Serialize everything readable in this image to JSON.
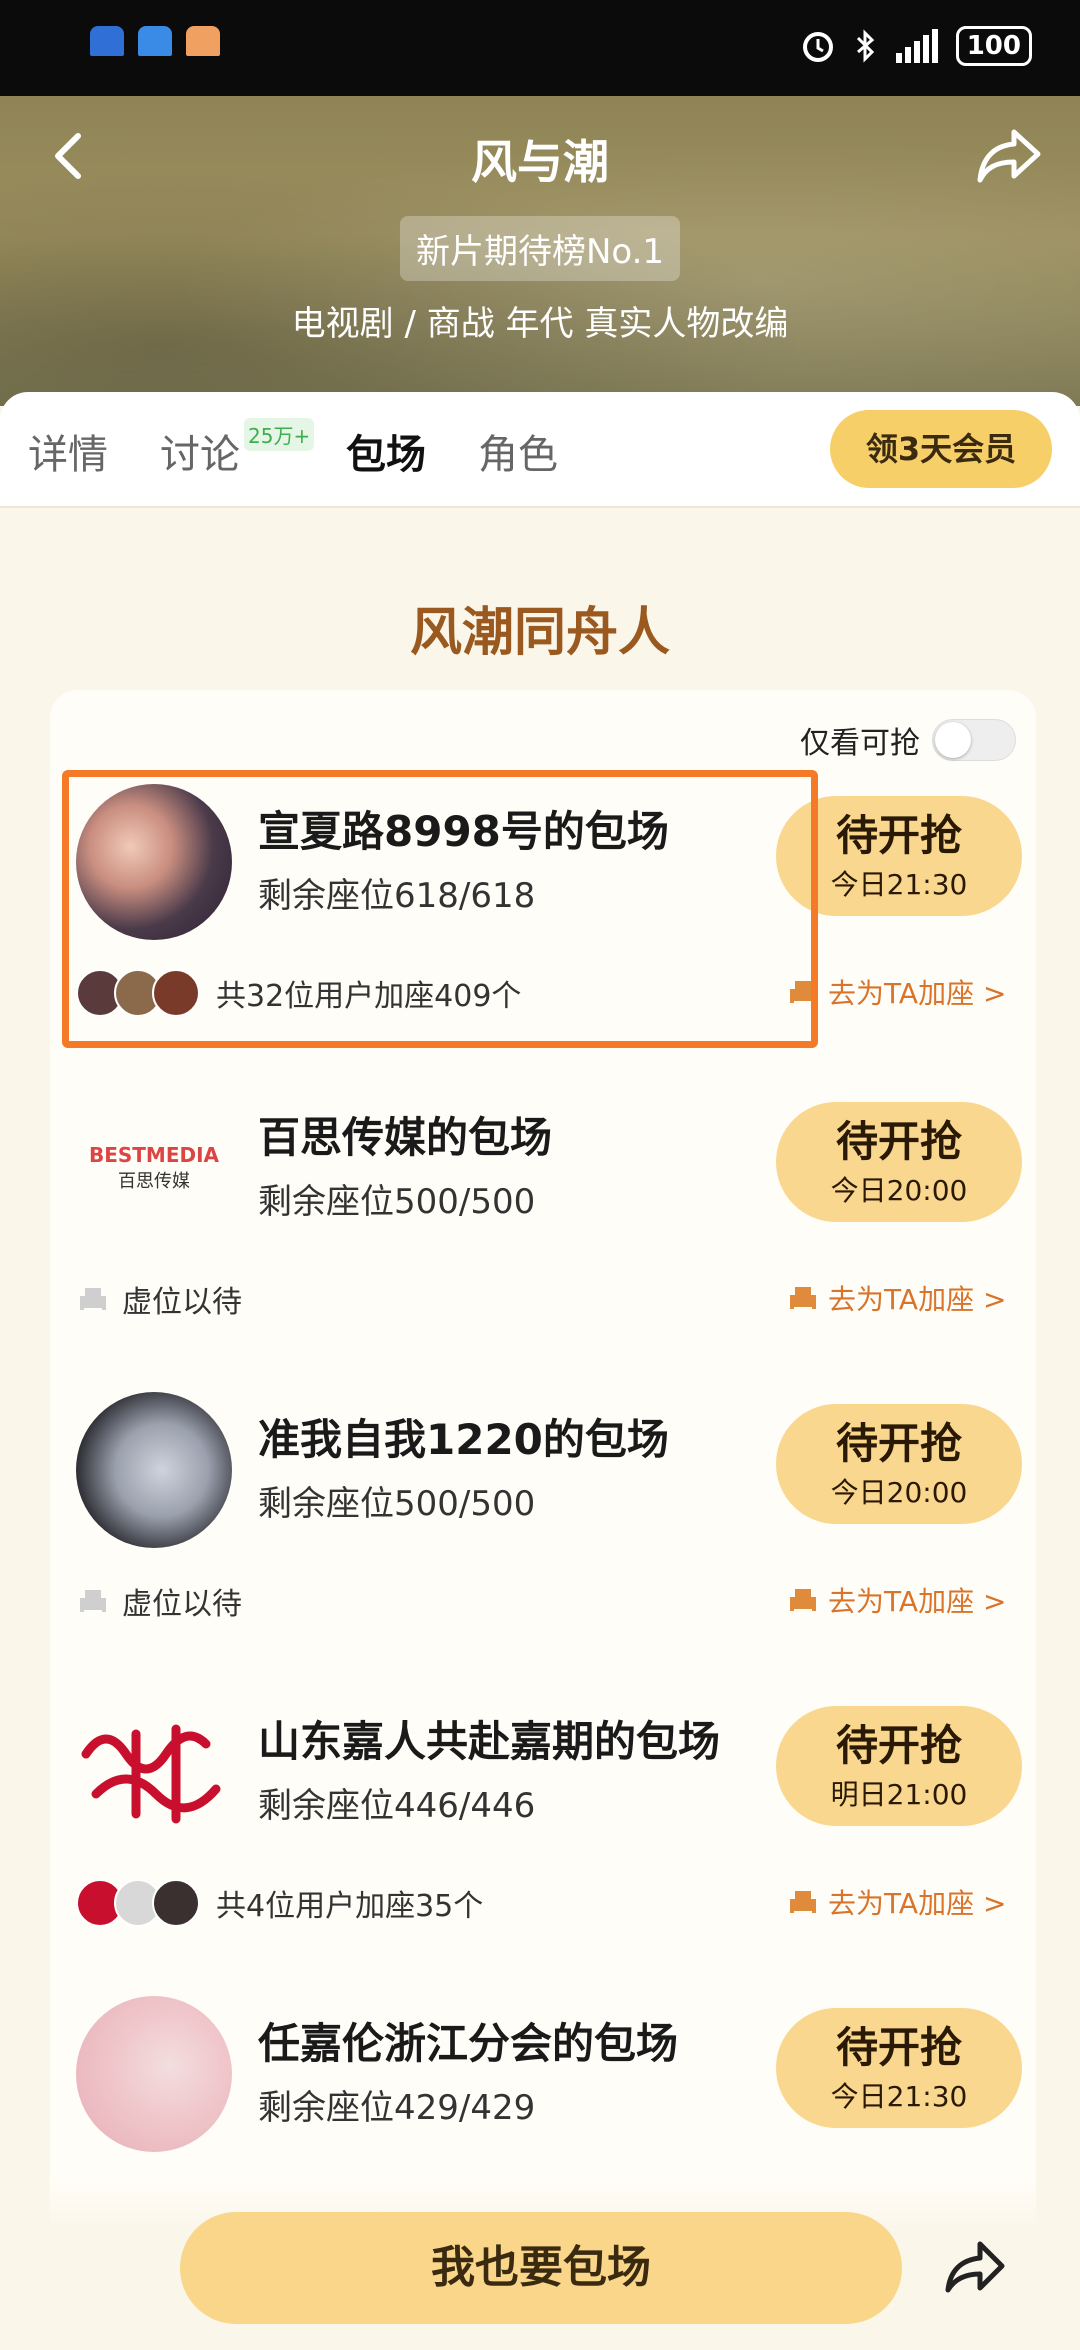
{
  "colors": {
    "accent": "#f9d78f",
    "highlight_border": "#f47a28",
    "section_title": "#9a5a1f",
    "link": "#d9742a"
  },
  "header": {
    "title": "风与潮",
    "badge": "新片期待榜No.1",
    "genre": "电视剧 / 商战 年代 真实人物改编"
  },
  "tabs": [
    {
      "label": "详情"
    },
    {
      "label": "讨论",
      "count": "25万+"
    },
    {
      "label": "包场",
      "active": true
    },
    {
      "label": "角色"
    }
  ],
  "vip_button": "领3天会员",
  "section_title": "风潮同舟人",
  "filter": {
    "label": "仅看可抢",
    "on": false
  },
  "items": [
    {
      "name": "宣夏路8998号的包场",
      "seats": "剩余座位618/618",
      "status": "待开抢",
      "time": "今日21:30",
      "footer": "共32位用户加座409个",
      "join": "去为TA加座 >",
      "avatar_icon": "couple-photo-icon"
    },
    {
      "name": "百思传媒的包场",
      "seats": "剩余座位500/500",
      "status": "待开抢",
      "time": "今日20:00",
      "footer": "虚位以待",
      "join": "去为TA加座 >",
      "logo_en": "BESTMEDIA",
      "logo_cn": "百思传媒"
    },
    {
      "name": "准我自我1220的包场",
      "seats": "剩余座位500/500",
      "status": "待开抢",
      "time": "今日20:00",
      "footer": "虚位以待",
      "join": "去为TA加座 >",
      "avatar_icon": "moon-silhouette-icon"
    },
    {
      "name": "山东嘉人共赴嘉期的包场",
      "seats": "剩余座位446/446",
      "status": "待开抢",
      "time": "明日21:00",
      "footer": "共4位用户加座35个",
      "join": "去为TA加座 >",
      "avatar_icon": "red-calligraphy-logo-icon"
    },
    {
      "name": "任嘉伦浙江分会的包场",
      "seats": "剩余座位429/429",
      "status": "待开抢",
      "time": "今日21:30",
      "footer": "",
      "join": "",
      "avatar_icon": "portrait-icon"
    }
  ],
  "cta": "我也要包场"
}
